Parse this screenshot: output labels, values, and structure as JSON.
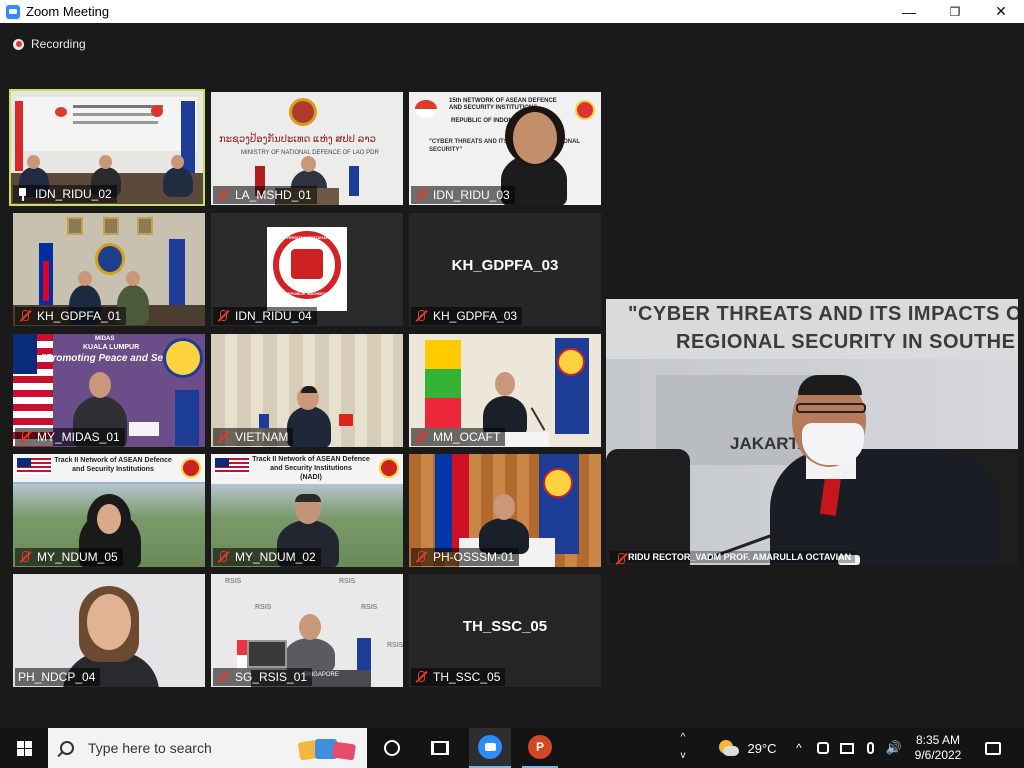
{
  "window": {
    "title": "Zoom Meeting",
    "minimize": "—",
    "restore": "❐",
    "close": "✕"
  },
  "meeting": {
    "recording_label": "Recording",
    "tiles": [
      {
        "name": "IDN_RIDU_02",
        "status": "pinned",
        "active": true
      },
      {
        "name": "LA_MSHD_01",
        "status": "muted"
      },
      {
        "name": "IDN_RIDU_03",
        "status": "muted"
      },
      {
        "name": "KH_GDPFA_01",
        "status": "muted"
      },
      {
        "name": "IDN_RIDU_04",
        "status": "muted"
      },
      {
        "name": "KH_GDPFA_03",
        "status": "muted",
        "video_off": true
      },
      {
        "name": "MY_MIDAS_01",
        "status": "muted"
      },
      {
        "name": "VIETNAM",
        "status": "muted"
      },
      {
        "name": "MM_OCAFT",
        "status": "muted"
      },
      {
        "name": "MY_NDUM_05",
        "status": "muted"
      },
      {
        "name": "MY_NDUM_02",
        "status": "muted"
      },
      {
        "name": "PH-OSSSM-01",
        "status": "muted"
      },
      {
        "name": "PH_NDCP_04",
        "status": "muted"
      },
      {
        "name": "SG_RSIS_01",
        "status": "muted"
      },
      {
        "name": "TH_SSC_05",
        "status": "muted",
        "video_off": true
      }
    ],
    "tile_texts": {
      "la_banner_script": "ກະຊວງປ້ອງກັນປະເທດ ແຫ່ງ ສປປ ລາວ",
      "la_banner": "MINISTRY OF NATIONAL DEFENCE OF LAO PDR",
      "ridu3_banner": "15th NETWORK OF ASEAN DEFENCE AND SECURITY INSTITUTIONS",
      "ridu3_banner2": "REPUBLIC OF INDONESIA",
      "ridu3_banner3": "\"CYBER THREATS AND ITS IMPACTS ON REGIONAL SECURITY\"",
      "ridu4_logo_top": "UNIVERSITAS PERTAHANAN",
      "ridu4_logo_bottom": "REPUBLIK INDONESIA",
      "midas_title": "MiDAS",
      "midas_city": "KUALA LUMPUR",
      "midas_slogan": "\"Promoting Peace and Security\"",
      "ndum_banner": "Track II Network of ASEAN Defence and Security Institutions",
      "ndum_banner2": "(NADI)",
      "rsis": "RSIS",
      "sg_nameplate": "SINGAPORE"
    },
    "speaker": {
      "name": "RIDU RECTOR_VADM PROF. AMARULLA OCTAVIAN",
      "sign_line1": "\"CYBER THREATS AND ITS IMPACTS ON",
      "sign_line2": "REGIONAL SECURITY IN SOUTHE",
      "sign_line3": "JAKARTA"
    }
  },
  "taskbar": {
    "search_placeholder": "Type here to search",
    "weather": "29°C",
    "time": "8:35 AM",
    "date": "9/6/2022"
  },
  "colors": {
    "active_border": "#c8e05a",
    "muted_red": "#e0392d",
    "zoom_blue": "#2d8cff"
  }
}
